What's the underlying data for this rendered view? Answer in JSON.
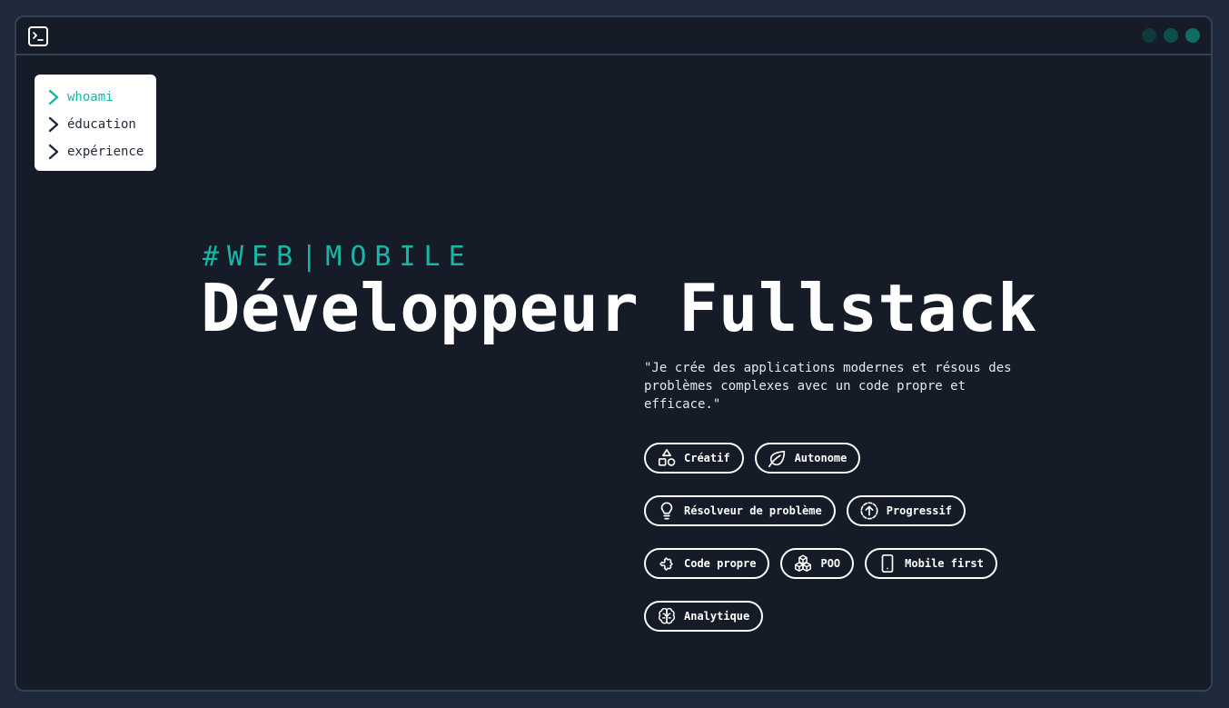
{
  "window": {
    "dots": [
      "#0f3a3c",
      "#0e4f4d",
      "#0f6b63"
    ]
  },
  "menu": {
    "items": [
      {
        "label": "whoami",
        "active": true
      },
      {
        "label": "éducation",
        "active": false
      },
      {
        "label": "expérience",
        "active": false
      }
    ]
  },
  "hero": {
    "tagline": "#WEB|MOBILE",
    "title": "Développeur Fullstack",
    "quote": "\"Je crée des applications modernes et résous des problèmes complexes avec un code propre et efficace.\""
  },
  "tags": [
    {
      "label": "Créatif",
      "icon": "shapes-icon"
    },
    {
      "label": "Autonome",
      "icon": "leaf-icon"
    },
    {
      "label": "Résolveur de problème",
      "icon": "lightbulb-icon"
    },
    {
      "label": "Progressif",
      "icon": "circle-arrow-up-icon"
    },
    {
      "label": "Code propre",
      "icon": "puzzle-icon"
    },
    {
      "label": "POO",
      "icon": "boxes-icon"
    },
    {
      "label": "Mobile first",
      "icon": "smartphone-icon"
    },
    {
      "label": "Analytique",
      "icon": "brain-icon"
    }
  ],
  "colors": {
    "accent": "#14b8a6",
    "background": "#151c27",
    "outer": "#1e293b"
  }
}
